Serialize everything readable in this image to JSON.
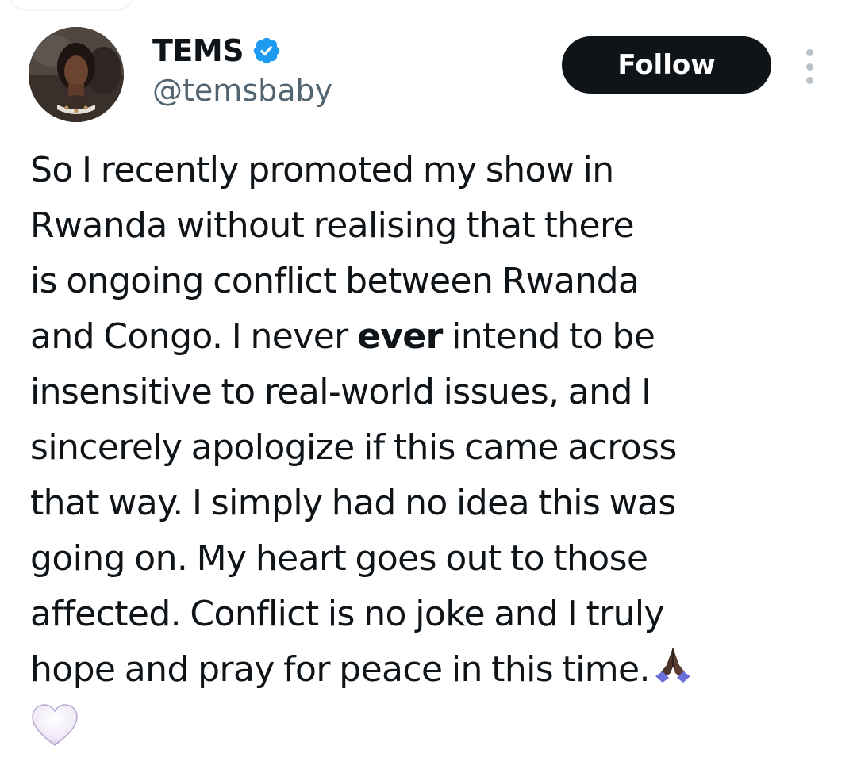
{
  "author": {
    "display_name": "TEMS",
    "handle": "@temsbaby",
    "verified": true,
    "verified_color": "#1d9bf0"
  },
  "actions": {
    "follow_label": "Follow",
    "more_icon": "more-vertical-icon"
  },
  "tweet": {
    "lines": [
      "So I recently promoted my show in",
      "Rwanda without realising that there",
      "is ongoing conflict between Rwanda"
    ],
    "line4_before": "and Congo. I never ",
    "line4_bold": "ever",
    "line4_after": " intend to be",
    "lines_rest": [
      "insensitive to real-world issues, and I",
      "sincerely apologize if this came across",
      "that way. I simply had no idea this was",
      "going on. My heart goes out to those",
      "affected. Conflict is no joke and I truly"
    ],
    "last_line": "hope and pray for peace in this time.",
    "emojis": [
      "folded-hands-icon",
      "white-heart-icon"
    ]
  },
  "colors": {
    "text": "#0f1419",
    "secondary": "#536471",
    "button_bg": "#0f1419",
    "button_text": "#ffffff"
  }
}
